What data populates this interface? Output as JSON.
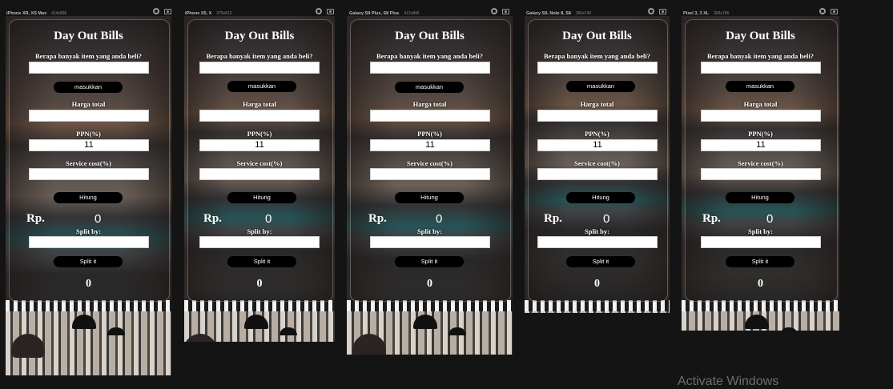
{
  "app": {
    "title": "Day Out Bills",
    "label_items": "Berapa banyak item yang anda beli?",
    "btn_input": "masukkan",
    "label_total": "Harga total",
    "label_vat": "PPN(%)",
    "vat_value": "11",
    "label_service": "Service cost(%)",
    "btn_calc": "Hitung",
    "currency": "Rp.",
    "total_value": "0",
    "label_split": "Split by:",
    "btn_split": "Split it",
    "split_value": "0"
  },
  "frames": [
    {
      "name": "iPhone XR, XS Max",
      "size": "414x896"
    },
    {
      "name": "iPhone X5, X",
      "size": "375x812"
    },
    {
      "name": "Galaxy S9 Plus, S8 Plus",
      "size": "412x846"
    },
    {
      "name": "Galaxy S9, Note 8, S8",
      "size": "360x740"
    },
    {
      "name": "Pixel 3, 3 XL",
      "size": "393x786"
    }
  ],
  "watermark": "Activate Windows",
  "colors": {
    "background": "#141414",
    "button": "#000000",
    "field": "#ffffff",
    "text": "#ffffff"
  },
  "icons": [
    "gear-icon",
    "camera-icon"
  ]
}
